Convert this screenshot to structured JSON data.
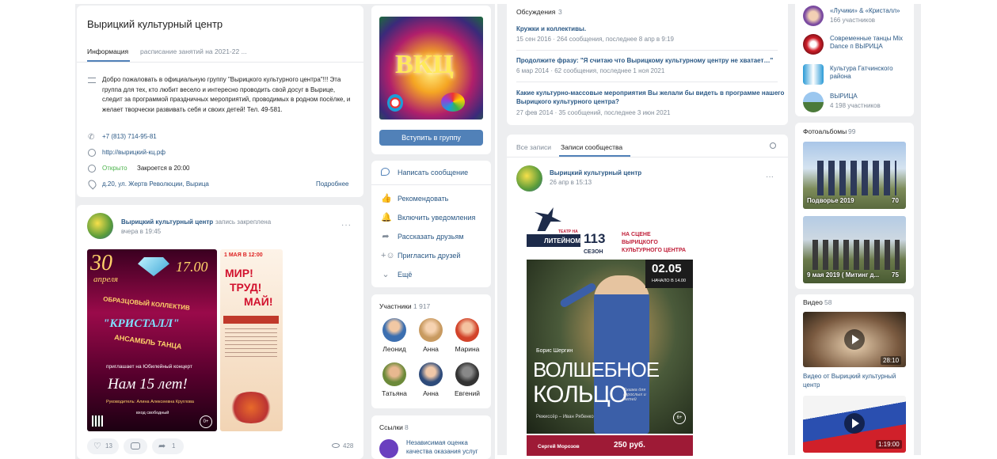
{
  "info": {
    "title": "Вырицкий культурный центр",
    "tabs": [
      "Информация",
      "расписание занятий на 2021-22 ..."
    ],
    "description": "Добро пожаловать в официальную группу \"Вырицкого культурного центра\"!!! Эта группа для тех, кто любит весело и интересно проводить свой досуг в Вырице, следит за программой праздничных мероприятий, проводимых в родном посёлке, и желает творчески развивать себя и своих детей! Тел. 49-581.",
    "phone": "+7 (813) 714-95-81",
    "website": "http://вырицкий-кц.рф",
    "status_open": "Открыто",
    "status_close": "Закроется в 20:00",
    "address": "д.20, ул. Жертв Революции, Вырица",
    "more_link": "Подробнее"
  },
  "pinned_post": {
    "author": "Вырицкий культурный центр",
    "pinned_label": "запись закреплена",
    "time": "вчера в 19:45",
    "poster1": {
      "date": "30",
      "month": "апреля",
      "time": "17.00",
      "line1": "ОБРАЗЦОВЫЙ КОЛЛЕКТИВ",
      "name": "\"КРИСТАЛЛ\"",
      "line2": "АНСАМБЛЬ ТАНЦА",
      "line3": "приглашает на Юбилейный концерт",
      "headline": "Нам 15 лет!",
      "footer": "Руководитель: Алина Алексеевна Круглова",
      "free": "вход свободный",
      "age": "0+"
    },
    "poster2": {
      "date": "1 МАЯ В 12:00",
      "slogan1": "МИР!",
      "slogan2": "ТРУД!",
      "slogan3": "МАЙ!"
    },
    "likes": "13",
    "views": "428"
  },
  "cover": {
    "letters": "ВКЦ"
  },
  "join_button": "Вступить в группу",
  "actions": [
    "Написать сообщение",
    "Рекомендовать",
    "Включить уведомления",
    "Рассказать друзьям",
    "Пригласить друзей",
    "Ещё"
  ],
  "members": {
    "title": "Участники",
    "count": "1 917",
    "people": [
      "Леонид",
      "Анна",
      "Марина",
      "Татьяна",
      "Анна",
      "Евгений"
    ]
  },
  "links": {
    "title": "Ссылки",
    "count": "8",
    "item1": "Независимая оценка",
    "item2": "качества оказания услуг"
  },
  "discussions": {
    "title": "Обсуждения",
    "count": "3",
    "items": [
      {
        "title": "Кружки и коллективы.",
        "meta": "15 сен 2016 · 264 сообщения, последнее 8 апр в 9:19"
      },
      {
        "title": "Продолжите фразу: \"Я считаю что Вырицкому культурному центру не хватает…\"",
        "meta": "6 мар 2014 · 62 сообщения, последнее 1 ноя 2021"
      },
      {
        "title_1": "Какие культурно-массовые мероприятия Вы желали бы видеть в программе нашего",
        "title_2": "Вырицкого культурного центра?",
        "meta": "27 фев 2014 · 35 сообщений, последнее 3 июн 2021"
      }
    ]
  },
  "wall": {
    "tabs": [
      "Все записи",
      "Записи сообщества"
    ],
    "author": "Вырицкий культурный центр",
    "time": "26 апр в 15:13",
    "poster": {
      "theatre": "ЛИТЕЙНОМ",
      "theatre_small": "ТЕАТР НА",
      "season": "113",
      "season_word": "СЕЗОН",
      "stage1": "НА СЦЕНЕ",
      "stage2": "ВЫРИЦКОГО",
      "stage3": "КУЛЬТУРНОГО ЦЕНТРА",
      "date": "02.05",
      "start": "НАЧАЛО В 14.00",
      "author": "Борис Шергин",
      "title1": "ВОЛШЕБНОЕ",
      "title2": "КОЛЬЦО",
      "subtitle": "Сказка для взрослых и детей",
      "director": "Режиссёр – Иван Рябенко",
      "age": "6+",
      "actor": "Сергей Морозов",
      "price": "250 руб."
    }
  },
  "groups": [
    {
      "name": "«Лучики» & «Кристалл»",
      "sub": "166 участников"
    },
    {
      "name": "Современные танцы Mix Dance п ВЫРИЦА",
      "sub": ""
    },
    {
      "name": "Культура Гатчинского района",
      "sub": ""
    },
    {
      "name": "ВЫРИЦА",
      "sub": "4 198 участников"
    }
  ],
  "albums": {
    "title": "Фотоальбомы",
    "count": "99",
    "items": [
      {
        "caption": "Подворье 2019",
        "count": "70"
      },
      {
        "caption": "9 мая 2019 ( Митинг д...",
        "count": "75"
      }
    ]
  },
  "videos": {
    "title": "Видео",
    "count": "58",
    "items": [
      {
        "duration": "28:10",
        "title_1": "Видео от Вырицкий культурный",
        "title_2": "центр"
      },
      {
        "duration": "1:19:00"
      }
    ]
  },
  "colors": {
    "accent": "#5181b8",
    "link": "#2a5885",
    "muted": "#818c99",
    "open_green": "#4bb34b",
    "background": "#edeef0"
  }
}
